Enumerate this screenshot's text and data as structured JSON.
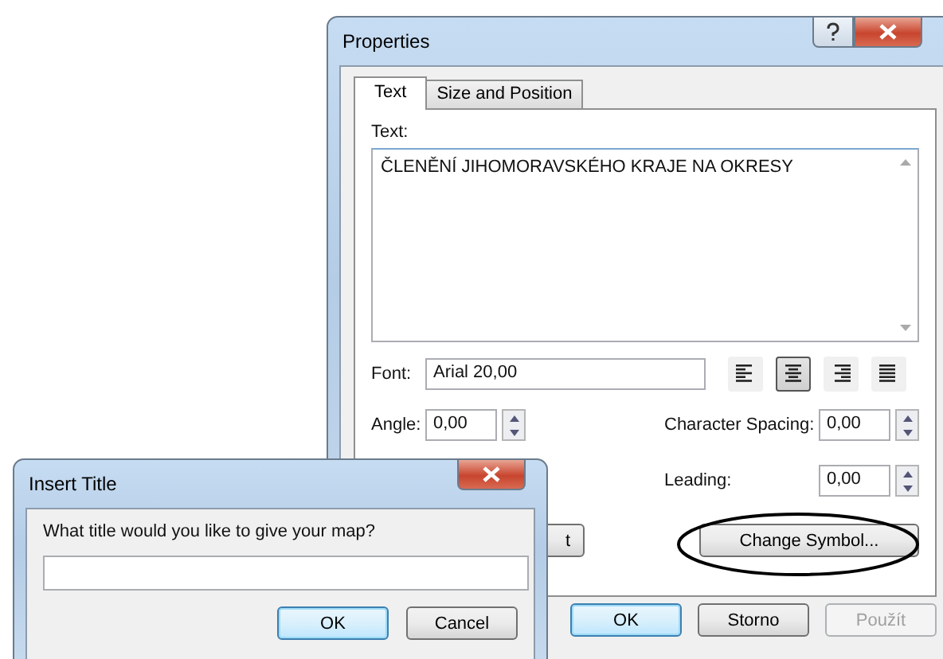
{
  "properties_window": {
    "title": "Properties",
    "tabs": [
      {
        "label": "Text",
        "selected": true
      },
      {
        "label": "Size and Position",
        "selected": false
      }
    ],
    "text_label": "Text:",
    "text_value": "ČLENĚNÍ JIHOMORAVSKÉHO KRAJE NA OKRESY",
    "font_label": "Font:",
    "font_value": "Arial 20,00",
    "alignment": [
      {
        "kind": "left",
        "selected": false
      },
      {
        "kind": "center",
        "selected": true
      },
      {
        "kind": "right",
        "selected": false
      },
      {
        "kind": "justify",
        "selected": false
      }
    ],
    "angle_label": "Angle:",
    "angle_value": "0,00",
    "spacing_label": "Character Spacing:",
    "spacing_value": "0,00",
    "leading_label": "Leading:",
    "leading_value": "0,00",
    "hidden_button_label": "t",
    "symbol_button": "Change Symbol...",
    "buttons": [
      {
        "label": "OK",
        "default": true,
        "disabled": false
      },
      {
        "label": "Storno",
        "default": false,
        "disabled": false
      },
      {
        "label": "Použít",
        "default": false,
        "disabled": true
      }
    ]
  },
  "insert_title_window": {
    "title": "Insert Title",
    "prompt": "What title would you like to give your map?",
    "buttons": [
      {
        "label": "OK",
        "default": true
      },
      {
        "label": "Cancel",
        "default": false
      }
    ]
  }
}
